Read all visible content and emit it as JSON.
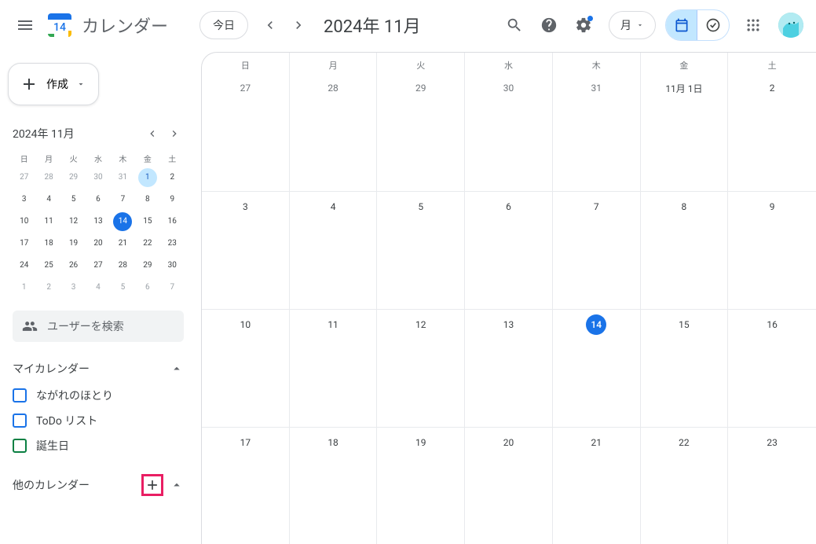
{
  "header": {
    "app_title": "カレンダー",
    "logo_day": "14",
    "today_btn": "今日",
    "date_title": "2024年 11月",
    "view_selector": "月"
  },
  "sidebar": {
    "create_label": "作成",
    "mini_title": "2024年 11月",
    "mini_dow": [
      "日",
      "月",
      "火",
      "水",
      "木",
      "金",
      "土"
    ],
    "mini_weeks": [
      [
        {
          "n": "27",
          "muted": true
        },
        {
          "n": "28",
          "muted": true
        },
        {
          "n": "29",
          "muted": true
        },
        {
          "n": "30",
          "muted": true
        },
        {
          "n": "31",
          "muted": true
        },
        {
          "n": "1",
          "today": true
        },
        {
          "n": "2"
        }
      ],
      [
        {
          "n": "3"
        },
        {
          "n": "4"
        },
        {
          "n": "5"
        },
        {
          "n": "6"
        },
        {
          "n": "7"
        },
        {
          "n": "8"
        },
        {
          "n": "9"
        }
      ],
      [
        {
          "n": "10"
        },
        {
          "n": "11"
        },
        {
          "n": "12"
        },
        {
          "n": "13"
        },
        {
          "n": "14",
          "selected": true
        },
        {
          "n": "15"
        },
        {
          "n": "16"
        }
      ],
      [
        {
          "n": "17"
        },
        {
          "n": "18"
        },
        {
          "n": "19"
        },
        {
          "n": "20"
        },
        {
          "n": "21"
        },
        {
          "n": "22"
        },
        {
          "n": "23"
        }
      ],
      [
        {
          "n": "24"
        },
        {
          "n": "25"
        },
        {
          "n": "26"
        },
        {
          "n": "27"
        },
        {
          "n": "28"
        },
        {
          "n": "29"
        },
        {
          "n": "30"
        }
      ],
      [
        {
          "n": "1",
          "muted": true
        },
        {
          "n": "2",
          "muted": true
        },
        {
          "n": "3",
          "muted": true
        },
        {
          "n": "4",
          "muted": true
        },
        {
          "n": "5",
          "muted": true
        },
        {
          "n": "6",
          "muted": true
        },
        {
          "n": "7",
          "muted": true
        }
      ]
    ],
    "search_people": "ユーザーを検索",
    "my_calendars_label": "マイカレンダー",
    "calendars": [
      {
        "label": "ながれのほとり",
        "color": "#1a73e8"
      },
      {
        "label": "ToDo リスト",
        "color": "#1a73e8"
      },
      {
        "label": "誕生日",
        "color": "#0b8043"
      }
    ],
    "other_calendars_label": "他のカレンダー"
  },
  "grid": {
    "dow": [
      "日",
      "月",
      "火",
      "水",
      "木",
      "金",
      "土"
    ],
    "weeks": [
      [
        {
          "n": "27",
          "muted": true
        },
        {
          "n": "28",
          "muted": true
        },
        {
          "n": "29",
          "muted": true
        },
        {
          "n": "30",
          "muted": true
        },
        {
          "n": "31",
          "muted": true
        },
        {
          "n": "11月 1日"
        },
        {
          "n": "2"
        }
      ],
      [
        {
          "n": "3"
        },
        {
          "n": "4"
        },
        {
          "n": "5"
        },
        {
          "n": "6"
        },
        {
          "n": "7"
        },
        {
          "n": "8"
        },
        {
          "n": "9"
        }
      ],
      [
        {
          "n": "10"
        },
        {
          "n": "11"
        },
        {
          "n": "12"
        },
        {
          "n": "13"
        },
        {
          "n": "14",
          "today": true
        },
        {
          "n": "15"
        },
        {
          "n": "16"
        }
      ],
      [
        {
          "n": "17"
        },
        {
          "n": "18"
        },
        {
          "n": "19"
        },
        {
          "n": "20"
        },
        {
          "n": "21"
        },
        {
          "n": "22"
        },
        {
          "n": "23"
        }
      ]
    ]
  }
}
